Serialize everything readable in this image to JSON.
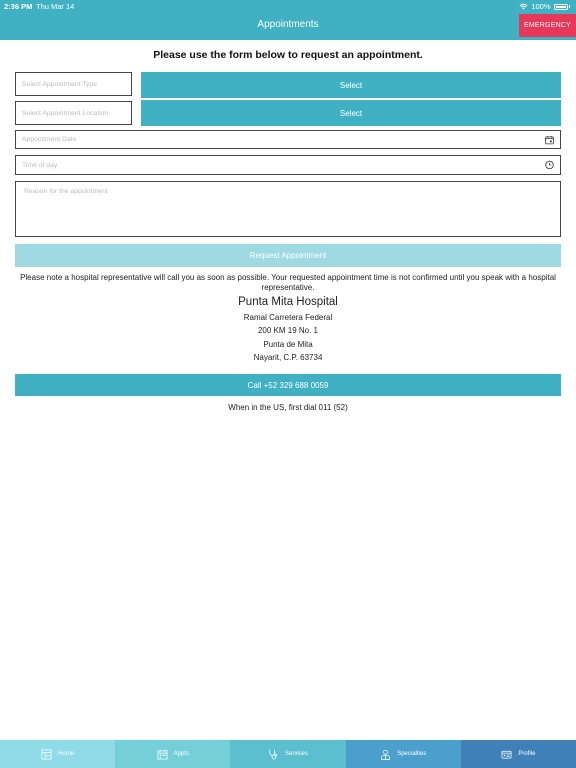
{
  "status_bar": {
    "time": "2:36 PM",
    "date": "Thu Mar 14",
    "battery": "100%"
  },
  "header": {
    "title": "Appointments",
    "emergency_label": "EMERGENCY"
  },
  "form": {
    "intro": "Please use the form below to request an appointment.",
    "appointment_type_placeholder": "Select Appointment Type",
    "appointment_location_placeholder": "Select Appointment Location",
    "select_label_1": "Select",
    "select_label_2": "Select",
    "date_placeholder": "Appointment Date",
    "time_placeholder": "Time of day",
    "reason_placeholder": "Reason for the appointment",
    "request_button": "Request Appointment"
  },
  "note": "Please note a hospital representative will call you as soon as possible.  Your requested appointment time is not confirmed until you speak with a hospital representative.",
  "hospital": {
    "name": "Punta Mita Hospital",
    "address": [
      "Ramal Carretera Federal",
      "200 KM 19 No. 1",
      "Punta de Mita",
      "Nayarit, C.P. 63734"
    ],
    "call_button": "Call +52 329 688 0059",
    "dial_note": "When in the US, first dial 011 (52)"
  },
  "tabs": [
    {
      "label": "Home",
      "icon": "home-icon",
      "color": "#8fdbe8"
    },
    {
      "label": "Appts",
      "icon": "calendar-icon",
      "color": "#74cfd8"
    },
    {
      "label": "Services",
      "icon": "stethoscope-icon",
      "color": "#5bbfcf"
    },
    {
      "label": "Specialties",
      "icon": "doctor-icon",
      "color": "#4a9fcc"
    },
    {
      "label": "Profile",
      "icon": "id-card-icon",
      "color": "#3f80b8"
    }
  ],
  "colors": {
    "primary": "#3fb1c3",
    "emergency": "#e8385a",
    "request_disabled": "#9fd9e2"
  }
}
